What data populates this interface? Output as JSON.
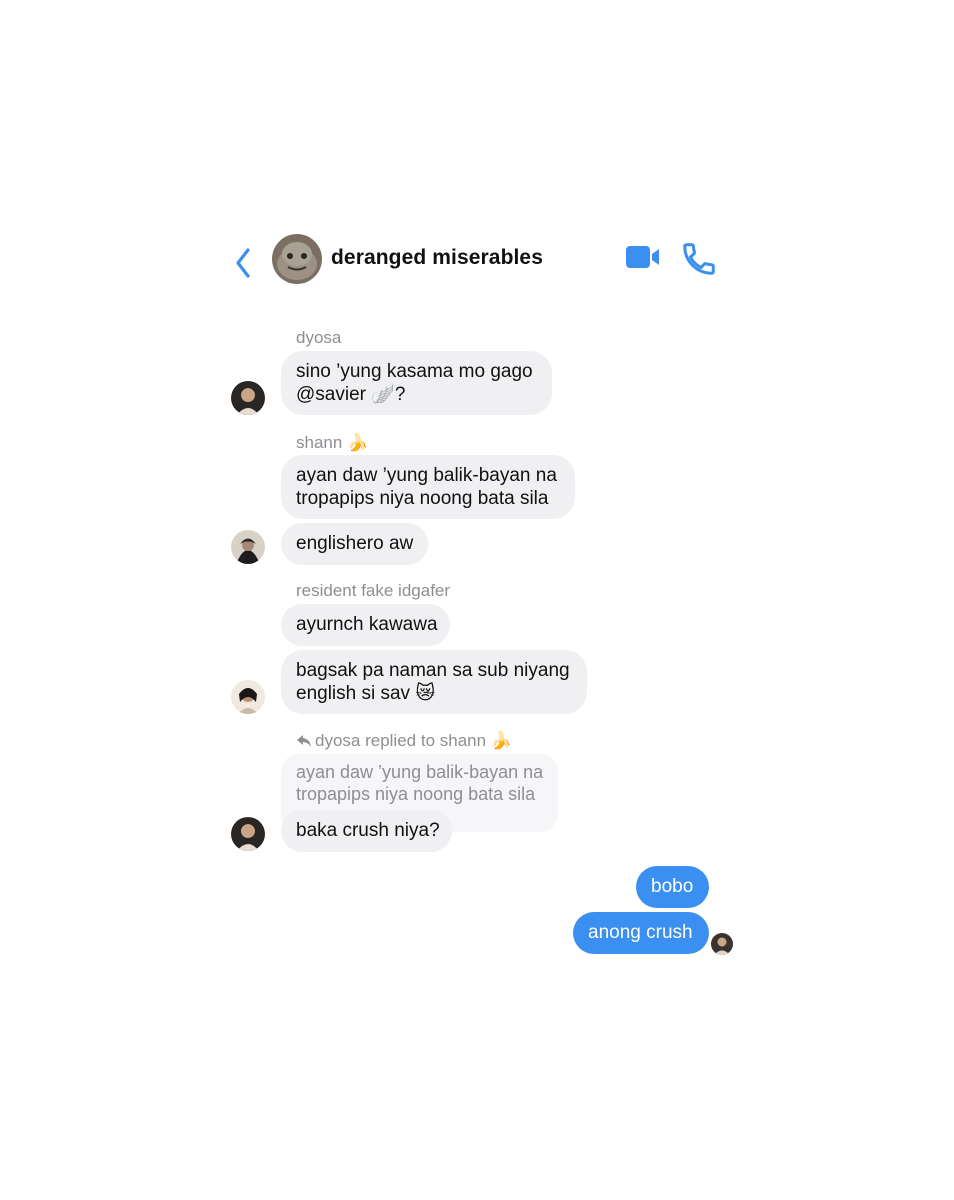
{
  "header": {
    "title": "deranged miserables",
    "back_icon": "chevron-left-icon",
    "video_icon": "video-camera-icon",
    "call_icon": "phone-icon",
    "accent": "#3b8ff0"
  },
  "messages": [
    {
      "sender": "dyosa",
      "lines": [
        "sino ’yung kasama mo gago",
        "@savier 🪽?"
      ]
    },
    {
      "sender": "shann 🍌",
      "lines": [
        "ayan daw ’yung balik-bayan na",
        "tropapips niya noong bata sila"
      ],
      "second": "englishero aw"
    },
    {
      "sender": "resident fake idgafer",
      "first": "ayurnch kawawa",
      "lines": [
        "bagsak pa naman sa sub niyang",
        "english si sav 😿"
      ]
    },
    {
      "reply_label": "dyosa replied to shann 🍌",
      "quoted": [
        "ayan daw ’yung balik-bayan na",
        "tropapips niya noong bata sila"
      ],
      "text": "baka crush niya?"
    }
  ],
  "outgoing": [
    "bobo",
    "anong crush"
  ]
}
